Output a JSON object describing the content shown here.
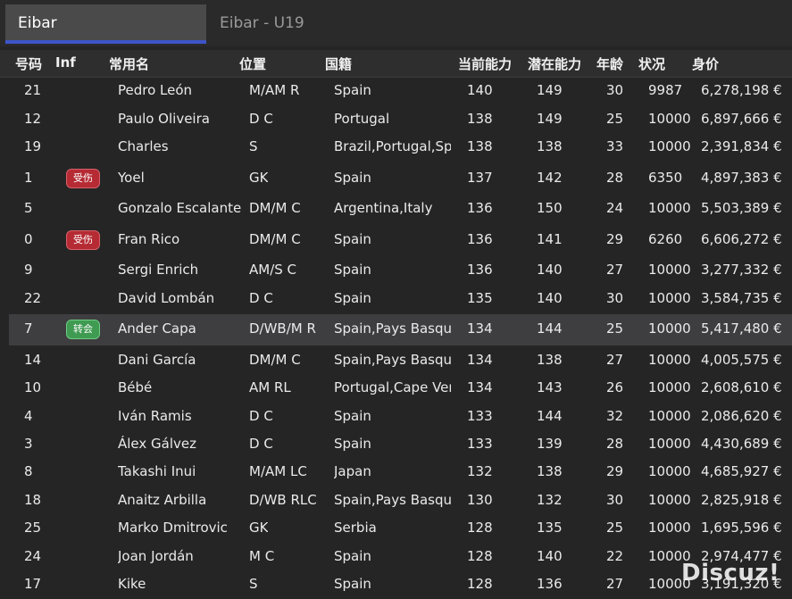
{
  "tabs": [
    {
      "label": "Eibar"
    },
    {
      "label": "Eibar - U19"
    }
  ],
  "columns": [
    "号码",
    "Inf",
    "常用名",
    "位置",
    "国籍",
    "当前能力",
    "潜在能力",
    "年龄",
    "状况",
    "身价"
  ],
  "players": [
    {
      "number": "21",
      "inf": "",
      "name": "Pedro León",
      "position": "M/AM R",
      "nationality": "Spain",
      "ca": "140",
      "pa": "149",
      "age": "30",
      "condition": "9987",
      "value": "6,278,198 €"
    },
    {
      "number": "12",
      "inf": "",
      "name": "Paulo Oliveira",
      "position": "D C",
      "nationality": "Portugal",
      "ca": "138",
      "pa": "149",
      "age": "25",
      "condition": "10000",
      "value": "6,897,666 €"
    },
    {
      "number": "19",
      "inf": "",
      "name": "Charles",
      "position": "S",
      "nationality": "Brazil,Portugal,Spa",
      "ca": "138",
      "pa": "138",
      "age": "33",
      "condition": "10000",
      "value": "2,391,834 €"
    },
    {
      "number": "1",
      "inf": "受伤",
      "inf_type": "injury",
      "name": "Yoel",
      "position": "GK",
      "nationality": "Spain",
      "ca": "137",
      "pa": "142",
      "age": "28",
      "condition": "6350",
      "value": "4,897,383 €"
    },
    {
      "number": "5",
      "inf": "",
      "name": "Gonzalo Escalante",
      "position": "DM/M C",
      "nationality": "Argentina,Italy",
      "ca": "136",
      "pa": "150",
      "age": "24",
      "condition": "10000",
      "value": "5,503,389 €"
    },
    {
      "number": "0",
      "inf": "受伤",
      "inf_type": "injury",
      "name": "Fran Rico",
      "position": "DM/M C",
      "nationality": "Spain",
      "ca": "136",
      "pa": "141",
      "age": "29",
      "condition": "6260",
      "value": "6,606,272 €"
    },
    {
      "number": "9",
      "inf": "",
      "name": "Sergi Enrich",
      "position": "AM/S C",
      "nationality": "Spain",
      "ca": "136",
      "pa": "140",
      "age": "27",
      "condition": "10000",
      "value": "3,277,332 €"
    },
    {
      "number": "22",
      "inf": "",
      "name": "David Lombán",
      "position": "D C",
      "nationality": "Spain",
      "ca": "135",
      "pa": "140",
      "age": "30",
      "condition": "10000",
      "value": "3,584,735 €"
    },
    {
      "number": "7",
      "inf": "转会",
      "inf_type": "transfer",
      "name": "Ander Capa",
      "position": "D/WB/M R",
      "nationality": "Spain,Pays Basque",
      "ca": "134",
      "pa": "144",
      "age": "25",
      "condition": "10000",
      "value": "5,417,480 €",
      "selected": true
    },
    {
      "number": "14",
      "inf": "",
      "name": "Dani García",
      "position": "DM/M C",
      "nationality": "Spain,Pays Basque",
      "ca": "134",
      "pa": "138",
      "age": "27",
      "condition": "10000",
      "value": "4,005,575 €"
    },
    {
      "number": "10",
      "inf": "",
      "name": "Bébé",
      "position": "AM RL",
      "nationality": "Portugal,Cape Verde",
      "ca": "134",
      "pa": "143",
      "age": "26",
      "condition": "10000",
      "value": "2,608,610 €"
    },
    {
      "number": "4",
      "inf": "",
      "name": "Iván Ramis",
      "position": "D C",
      "nationality": "Spain",
      "ca": "133",
      "pa": "144",
      "age": "32",
      "condition": "10000",
      "value": "2,086,620 €"
    },
    {
      "number": "3",
      "inf": "",
      "name": "Álex Gálvez",
      "position": "D C",
      "nationality": "Spain",
      "ca": "133",
      "pa": "139",
      "age": "28",
      "condition": "10000",
      "value": "4,430,689 €"
    },
    {
      "number": "8",
      "inf": "",
      "name": "Takashi Inui",
      "position": "M/AM LC",
      "nationality": "Japan",
      "ca": "132",
      "pa": "138",
      "age": "29",
      "condition": "10000",
      "value": "4,685,927 €"
    },
    {
      "number": "18",
      "inf": "",
      "name": "Anaitz Arbilla",
      "position": "D/WB RLC",
      "nationality": "Spain,Pays Basque",
      "ca": "130",
      "pa": "132",
      "age": "30",
      "condition": "10000",
      "value": "2,825,918 €"
    },
    {
      "number": "25",
      "inf": "",
      "name": "Marko Dmitrovic",
      "position": "GK",
      "nationality": "Serbia",
      "ca": "128",
      "pa": "135",
      "age": "25",
      "condition": "10000",
      "value": "1,695,596 €"
    },
    {
      "number": "24",
      "inf": "",
      "name": "Joan Jordán",
      "position": "M C",
      "nationality": "Spain",
      "ca": "128",
      "pa": "140",
      "age": "22",
      "condition": "10000",
      "value": "2,974,477 €"
    },
    {
      "number": "17",
      "inf": "",
      "name": "Kike",
      "position": "S",
      "nationality": "Spain",
      "ca": "128",
      "pa": "136",
      "age": "27",
      "condition": "10000",
      "value": "3,191,320 €"
    }
  ],
  "watermark": "Discuz!"
}
